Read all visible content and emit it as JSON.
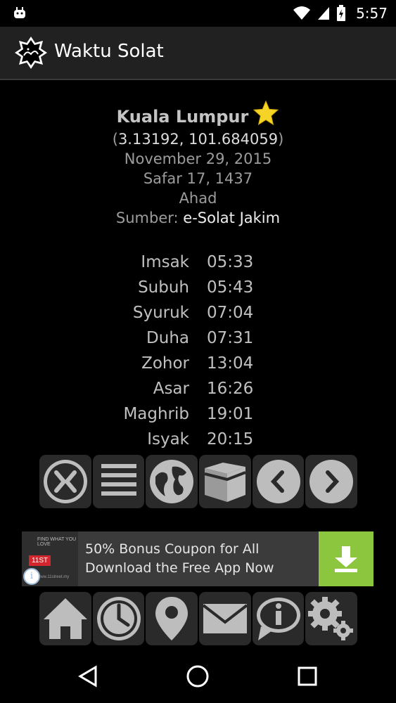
{
  "status_bar": {
    "time": "5:57",
    "icons": [
      "android-icon",
      "wifi-icon",
      "signal-icon",
      "battery-charging-icon"
    ]
  },
  "app_bar": {
    "title": "Waktu Solat",
    "logo": "solat-logo-icon"
  },
  "location": {
    "city": "Kuala Lumpur",
    "coordinates": "3.13192, 101.684059",
    "gregorian_date": "November 29, 2015",
    "hijri_date": "Safar 17, 1437",
    "day": "Ahad",
    "source_label": "Sumber:",
    "source_value": "e-Solat Jakim"
  },
  "prayer_times": [
    {
      "name": "Imsak",
      "time": "05:33"
    },
    {
      "name": "Subuh",
      "time": "05:43"
    },
    {
      "name": "Syuruk",
      "time": "07:04"
    },
    {
      "name": "Duha",
      "time": "07:31"
    },
    {
      "name": "Zohor",
      "time": "13:04"
    },
    {
      "name": "Asar",
      "time": "16:26"
    },
    {
      "name": "Maghrib",
      "time": "19:01"
    },
    {
      "name": "Isyak",
      "time": "20:15"
    }
  ],
  "toolbar": [
    "close-circle-icon",
    "menu-icon",
    "globe-icon",
    "kaaba-icon",
    "chevron-left-icon",
    "chevron-right-icon"
  ],
  "ad": {
    "line1": "50% Bonus Coupon for All",
    "line2": "Download the Free App Now",
    "brand": "11ST",
    "brand_tag": "FIND WHAT YOU LOVE",
    "brand_url": "www.11street.my",
    "info_glyph": "i"
  },
  "bottom_nav": [
    "home-icon",
    "clock-icon",
    "map-pin-icon",
    "mail-icon",
    "info-bubble-icon",
    "settings-gears-icon"
  ]
}
